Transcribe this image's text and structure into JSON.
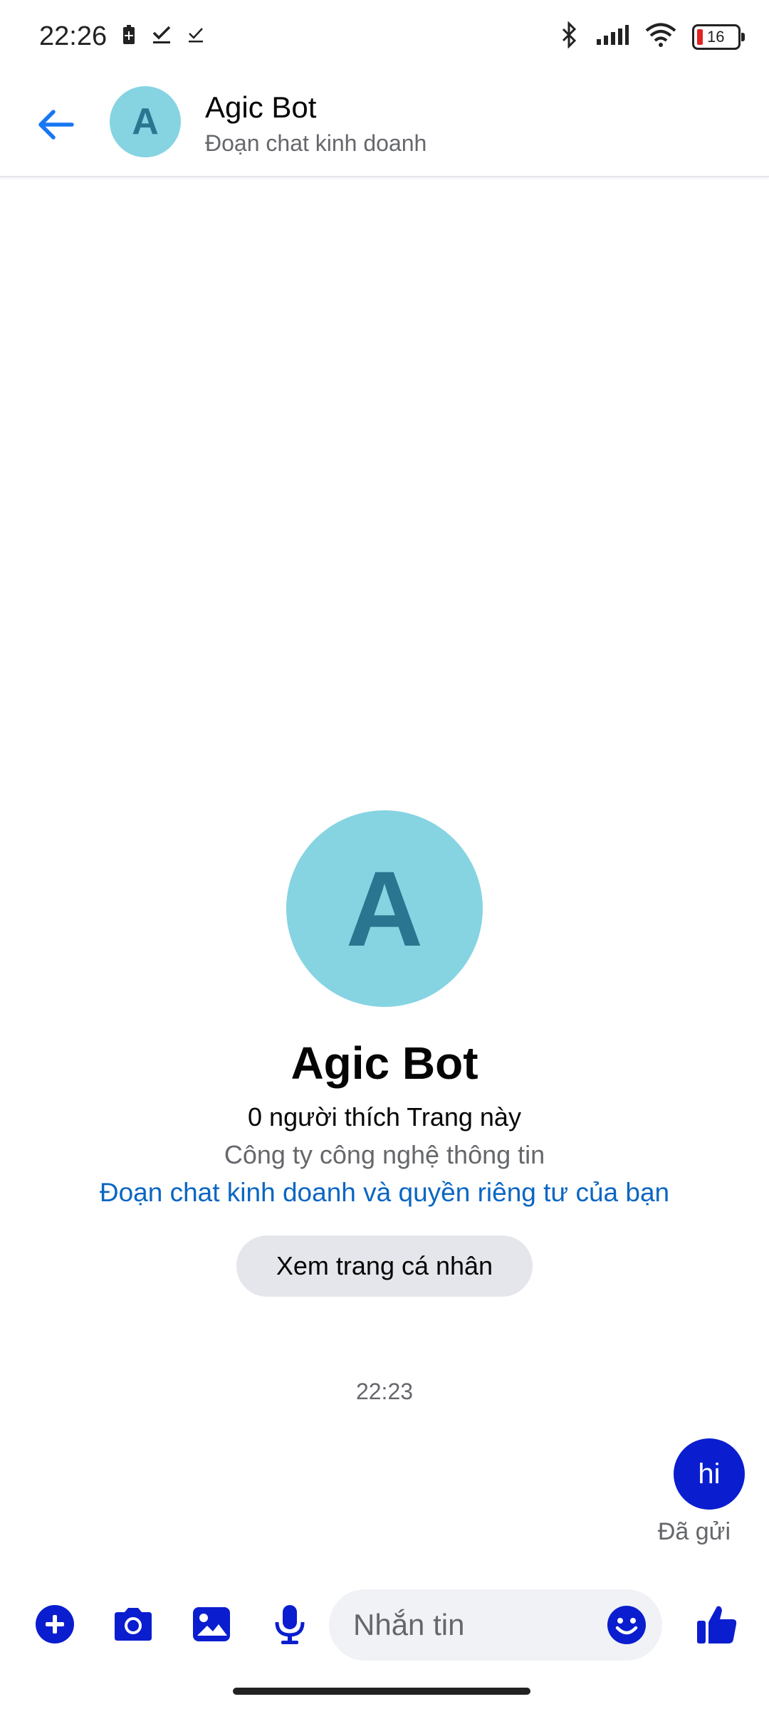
{
  "status_bar": {
    "time": "22:26",
    "battery_level": "16",
    "icons": [
      "battery-saver-icon",
      "checkbox-icon",
      "checkbox-icon",
      "bluetooth-icon",
      "signal-icon",
      "wifi-icon",
      "battery-icon"
    ]
  },
  "header": {
    "avatar_letter": "A",
    "title": "Agic Bot",
    "subtitle": "Đoạn chat kinh doanh"
  },
  "profile": {
    "avatar_letter": "A",
    "name": "Agic Bot",
    "likes": "0 người thích Trang này",
    "category": "Công ty công nghệ thông tin",
    "privacy_link": "Đoạn chat kinh doanh và quyền riêng tư của bạn",
    "view_profile_label": "Xem trang cá nhân"
  },
  "conversation": {
    "timestamp": "22:23",
    "messages": [
      {
        "text": "hi",
        "from": "me"
      }
    ],
    "status": "Đã gửi"
  },
  "composer": {
    "placeholder": "Nhắn tin",
    "icons": [
      "add-icon",
      "camera-icon",
      "gallery-icon",
      "microphone-icon",
      "emoji-icon",
      "like-icon"
    ]
  },
  "colors": {
    "accent": "#0a1ecf",
    "link": "#0a66c2",
    "avatar_bg": "#86d4e2",
    "avatar_fg": "#2a7590"
  }
}
